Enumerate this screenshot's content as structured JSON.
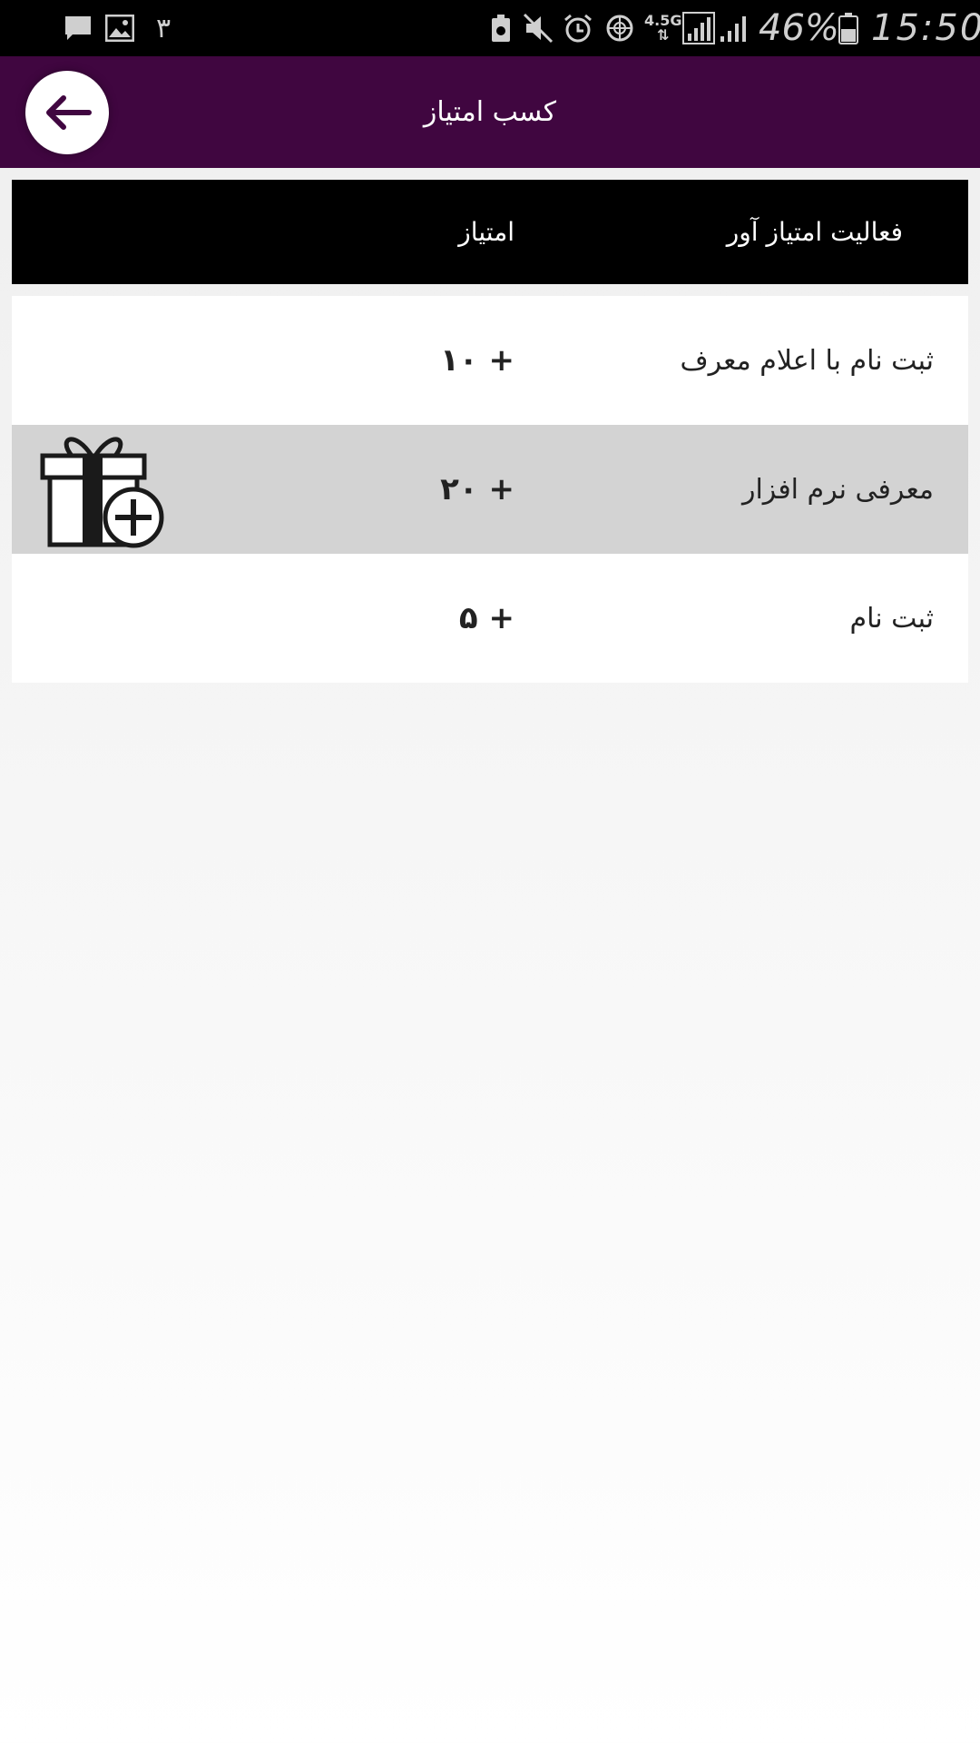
{
  "status_bar": {
    "notification_count": "٣",
    "network_type": "4.5G",
    "battery_percent": "46%",
    "time": "15:50",
    "icons": [
      "message-icon",
      "image-icon",
      "cast-icon",
      "mute-icon",
      "alarm-icon",
      "globe-icon",
      "signal-icon",
      "signal-icon",
      "battery-icon"
    ]
  },
  "header": {
    "title": "کسب امتیاز",
    "background": "#400640",
    "back_icon": "arrow-left-icon"
  },
  "table": {
    "columns": {
      "activity": "فعالیت امتیاز آور",
      "score": "امتیاز"
    },
    "rows": [
      {
        "activity": "ثبت نام با اعلام معرف",
        "score": "+ ١٠"
      },
      {
        "activity": "معرفی نرم افزار",
        "score": "+ ٢٠",
        "icon": "gift-add-icon"
      },
      {
        "activity": "ثبت نام",
        "score": "+ ۵"
      }
    ]
  }
}
